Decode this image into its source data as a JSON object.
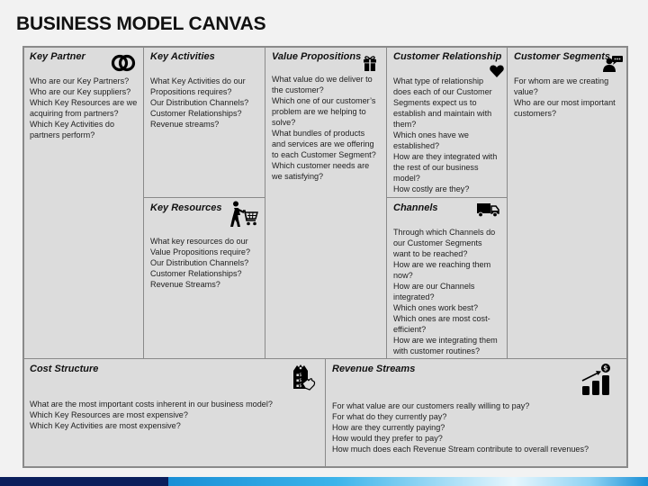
{
  "page": {
    "title": "BUSINESS MODEL CANVAS"
  },
  "canvas": {
    "key_partner": {
      "heading": "Key Partner",
      "icon": "interlinked-rings-icon",
      "lines": [
        "Who are our Key Partners?",
        "Who are our Key suppliers?",
        "Which Key Resources are we",
        "acquiring from partners?",
        "Which Key Activities do",
        "partners perform?"
      ]
    },
    "key_activities": {
      "heading": "Key Activities",
      "lines": [
        "What Key Activities do our",
        "Propositions requires?",
        "Our Distribution Channels?",
        "Customer Relationships?",
        "Revenue streams?"
      ]
    },
    "key_resources": {
      "heading": "Key Resources",
      "icon": "person-pushing-cart-icon",
      "lines": [
        "What key resources do our",
        "Value Propositions require?",
        "Our Distribution Channels?",
        "Customer Relationships?",
        "Revenue Streams?"
      ]
    },
    "value_propositions": {
      "heading": "Value Propositions",
      "icon": "gift-icon",
      "lines": [
        "What value do we deliver to",
        "the customer?",
        "Which one of our customer’s",
        "problem are we helping to",
        "solve?",
        "What bundles of products",
        "and services are we offering",
        "to each Customer Segment?",
        "Which customer needs are",
        "we satisfying?"
      ]
    },
    "customer_relationship": {
      "heading": "Customer Relationship",
      "icon": "heart-icon",
      "lines": [
        "What type of relationship",
        "does each of our Customer",
        "Segments expect us to",
        "establish and maintain with",
        "them?",
        "Which ones have we",
        "established?",
        "How are they integrated with",
        "the rest of our business",
        "model?",
        "How costly are they?"
      ]
    },
    "channels": {
      "heading": "Channels",
      "icon": "delivery-truck-icon",
      "lines": [
        "Through which Channels do",
        "our Customer Segments",
        "want to be reached?",
        "How are we reaching them",
        "now?",
        "How are our Channels",
        "integrated?",
        "Which ones work best?",
        "Which ones are most cost-",
        "efficient?",
        "How are we integrating them",
        "with customer routines?"
      ]
    },
    "customer_segments": {
      "heading": "Customer Segments",
      "icon": "person-speech-bubble-icon",
      "lines": [
        "For whom are we creating",
        "value?",
        "Who are our most important",
        "customers?"
      ]
    },
    "cost_structure": {
      "heading": "Cost Structure",
      "icon": "price-tag-hand-icon",
      "lines": [
        "What are the most important costs inherent in our business model?",
        "Which Key Resources are most expensive?",
        "Which Key Activities are most expensive?"
      ]
    },
    "revenue_streams": {
      "heading": "Revenue Streams",
      "icon": "growth-chart-dollar-icon",
      "lines": [
        "For what value are our customers really willing to pay?",
        "For what do they currently pay?",
        "How are they currently paying?",
        "How would they prefer to pay?",
        "How much does each Revenue Stream contribute to overall revenues?"
      ]
    }
  },
  "theme": {
    "background": "#f2f2f2",
    "cell_fill": "#dcdcdc",
    "border": "#8a8a8a",
    "bar_dark": "#0b1f5c",
    "bar_blue": "#1a8fd6",
    "bar_light": "#e6f6fd"
  }
}
